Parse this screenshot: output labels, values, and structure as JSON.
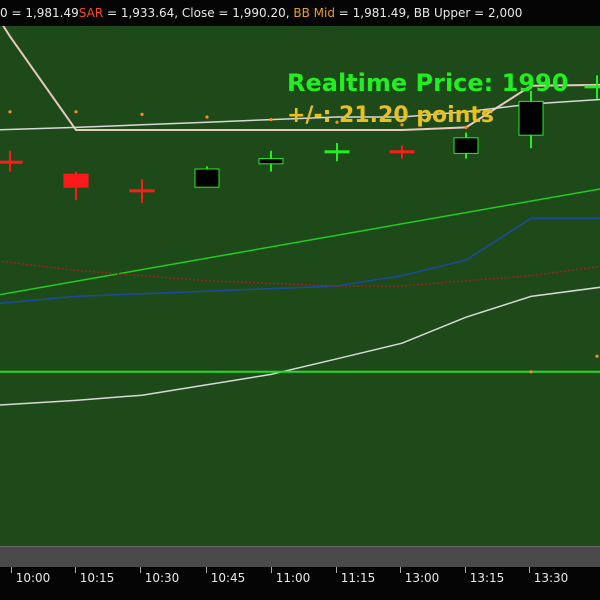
{
  "legend": {
    "items": [
      {
        "label": "0 = 1,981.49",
        "color": "#e8e8e8"
      },
      {
        "label": "SAR",
        "color": "#ff4a2a"
      },
      {
        "label": " = 1,933.64, ",
        "color": "#e8e8e8"
      },
      {
        "label": "Close = 1,990.20, ",
        "color": "#e8e8e8"
      },
      {
        "label": "BB Mid",
        "color": "#e8a020"
      },
      {
        "label": " = 1,981.49, BB Upper = 2,000",
        "color": "#e8e8e8"
      }
    ]
  },
  "realtime": {
    "price_text": "Realtime Price: 1990",
    "change_text": "+/-: 21.20 points"
  },
  "colors": {
    "plot_background": "#1e4a1a",
    "up_candle": "#22ee22",
    "down_candle": "#ff1a1a",
    "bb_upper": "#e8c8c0",
    "bb_mid": "#d8d8d8",
    "bb_lower": "#d8d8d8",
    "sar": "#ff8a2a",
    "green_line": "#22cc22",
    "blue_line": "#1a4aa0",
    "red_dotted": "#a02020",
    "support_line": "#22dd22"
  },
  "chart_data": {
    "type": "candlestick",
    "x": [
      "10:00",
      "10:15",
      "10:30",
      "10:45",
      "11:00",
      "11:15",
      "13:00",
      "13:15",
      "13:30"
    ],
    "candles": [
      {
        "time": "09:45",
        "open": 0.74,
        "close": 0.74,
        "high": 0.76,
        "low": 0.72,
        "dir": "down",
        "partial": true
      },
      {
        "time": "10:15",
        "open": 0.715,
        "close": 0.69,
        "high": 0.72,
        "low": 0.665,
        "dir": "down"
      },
      {
        "time": "10:30",
        "open": 0.685,
        "close": 0.685,
        "high": 0.705,
        "low": 0.66,
        "dir": "down"
      },
      {
        "time": "10:45",
        "open": 0.69,
        "close": 0.725,
        "high": 0.73,
        "low": 0.69,
        "dir": "up"
      },
      {
        "time": "11:00",
        "open": 0.735,
        "close": 0.745,
        "high": 0.76,
        "low": 0.72,
        "dir": "up"
      },
      {
        "time": "11:15",
        "open": 0.76,
        "close": 0.76,
        "high": 0.775,
        "low": 0.74,
        "dir": "up"
      },
      {
        "time": "13:00",
        "open": 0.76,
        "close": 0.76,
        "high": 0.77,
        "low": 0.745,
        "dir": "down"
      },
      {
        "time": "13:15",
        "open": 0.755,
        "close": 0.785,
        "high": 0.795,
        "low": 0.745,
        "dir": "up"
      },
      {
        "time": "13:30",
        "open": 0.79,
        "close": 0.855,
        "high": 0.875,
        "low": 0.765,
        "dir": "up"
      },
      {
        "time": "13:45",
        "open": 0.885,
        "close": 0.885,
        "high": 0.905,
        "low": 0.86,
        "dir": "up",
        "partial": true
      }
    ],
    "series": [
      {
        "role": "bb_upper",
        "points": [
          [
            "09:30",
            1.04
          ],
          [
            "09:45",
            0.98
          ],
          [
            "10:15",
            0.8
          ],
          [
            "10:30",
            0.8
          ],
          [
            "10:45",
            0.8
          ],
          [
            "11:00",
            0.8
          ],
          [
            "11:15",
            0.8
          ],
          [
            "13:00",
            0.8
          ],
          [
            "13:15",
            0.805
          ],
          [
            "13:30",
            0.885
          ],
          [
            "13:45",
            0.887
          ]
        ]
      },
      {
        "role": "bb_mid",
        "points": [
          [
            "09:30",
            0.8
          ],
          [
            "10:15",
            0.805
          ],
          [
            "10:30",
            0.81
          ],
          [
            "10:45",
            0.815
          ],
          [
            "11:00",
            0.82
          ],
          [
            "11:15",
            0.825
          ],
          [
            "13:00",
            0.825
          ],
          [
            "13:15",
            0.835
          ],
          [
            "13:30",
            0.85
          ],
          [
            "13:45",
            0.86
          ]
        ]
      },
      {
        "role": "bb_lower",
        "points": [
          [
            "09:30",
            0.27
          ],
          [
            "10:15",
            0.28
          ],
          [
            "10:30",
            0.29
          ],
          [
            "10:45",
            0.31
          ],
          [
            "11:00",
            0.33
          ],
          [
            "11:15",
            0.36
          ],
          [
            "13:00",
            0.39
          ],
          [
            "13:15",
            0.44
          ],
          [
            "13:30",
            0.48
          ],
          [
            "13:45",
            0.5
          ]
        ]
      },
      {
        "role": "green_line",
        "points": [
          [
            "09:30",
            0.48
          ],
          [
            "13:45",
            0.69
          ]
        ]
      },
      {
        "role": "blue_line",
        "points": [
          [
            "09:30",
            0.465
          ],
          [
            "10:15",
            0.48
          ],
          [
            "10:45",
            0.49
          ],
          [
            "11:15",
            0.5
          ],
          [
            "13:00",
            0.52
          ],
          [
            "13:15",
            0.55
          ],
          [
            "13:30",
            0.63
          ],
          [
            "13:45",
            0.63
          ]
        ]
      },
      {
        "role": "red_dotted",
        "points": [
          [
            "09:30",
            0.55
          ],
          [
            "10:15",
            0.53
          ],
          [
            "10:45",
            0.51
          ],
          [
            "11:15",
            0.5
          ],
          [
            "13:00",
            0.5
          ],
          [
            "13:30",
            0.52
          ],
          [
            "13:45",
            0.54
          ]
        ]
      },
      {
        "role": "support_line",
        "points": [
          [
            "09:30",
            0.335
          ],
          [
            "13:45",
            0.335
          ]
        ]
      }
    ],
    "sar_points": [
      [
        "09:45",
        0.835
      ],
      [
        "10:15",
        0.835
      ],
      [
        "10:30",
        0.83
      ],
      [
        "10:45",
        0.825
      ],
      [
        "11:00",
        0.82
      ],
      [
        "11:15",
        0.815
      ],
      [
        "13:00",
        0.81
      ],
      [
        "13:15",
        0.805
      ],
      [
        "13:30",
        0.335
      ],
      [
        "13:45",
        0.365
      ]
    ],
    "ylim": [
      0,
      1
    ],
    "grid": false
  }
}
